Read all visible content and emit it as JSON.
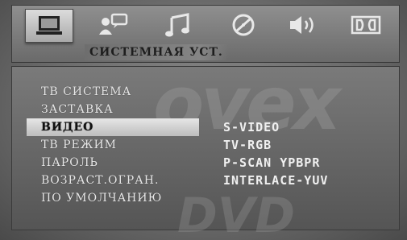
{
  "header": {
    "section_title": "СИСТЕМНАЯ УСТ.",
    "tabs": [
      {
        "icon": "monitor-icon",
        "active": true
      },
      {
        "icon": "person-speech-icon",
        "active": false
      },
      {
        "icon": "music-note-icon",
        "active": false
      },
      {
        "icon": "disc-icon",
        "active": false
      },
      {
        "icon": "speaker-icon",
        "active": false
      },
      {
        "icon": "dolby-icon",
        "active": false
      }
    ]
  },
  "menu": {
    "items": [
      {
        "label": "ТВ СИСТЕМА"
      },
      {
        "label": "ЗАСТАВКА"
      },
      {
        "label": "ВИДЕО"
      },
      {
        "label": "ТВ РЕЖИМ"
      },
      {
        "label": "ПАРОЛЬ"
      },
      {
        "label": "ВОЗРАСТ.ОГРАН."
      },
      {
        "label": "ПО УМОЛЧАНИЮ"
      }
    ],
    "selected_index": 2
  },
  "options": {
    "items": [
      {
        "label": "S-VIDEO"
      },
      {
        "label": "TV-RGB"
      },
      {
        "label": "P-SCAN YPBPR"
      },
      {
        "label": "INTERLACE-YUV"
      }
    ]
  },
  "background": {
    "watermark": "ovex",
    "watermark2": "DVD"
  }
}
